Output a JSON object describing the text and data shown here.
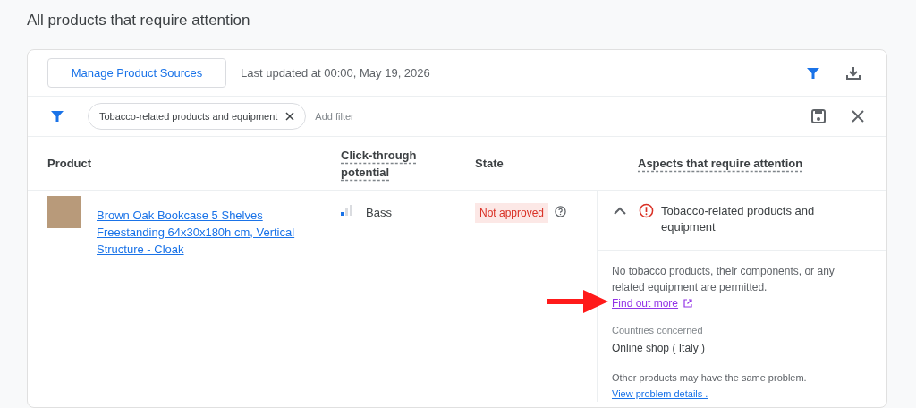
{
  "page_title": "All products that require attention",
  "toolbar": {
    "manage_button": "Manage Product Sources",
    "last_updated": "Last updated at 00:00, May 19, 2026"
  },
  "filter_bar": {
    "chips": [
      {
        "label": "Tobacco-related products and equipment"
      }
    ],
    "add_filter": "Add filter"
  },
  "table": {
    "columns": [
      {
        "label": "Product",
        "has_tooltip": false
      },
      {
        "label": "Click-through potential",
        "has_tooltip": true
      },
      {
        "label": "State",
        "has_tooltip": false
      },
      {
        "label": "Aspects that require attention",
        "has_tooltip": true
      }
    ],
    "rows": [
      {
        "product": "Brown Oak Bookcase 5 Shelves Freestanding 64x30x180h cm, Vertical Structure - Cloak",
        "potential": "Bass",
        "state": "Not approved",
        "aspect": {
          "title": "Tobacco-related products and equipment",
          "expanded": true,
          "description": "No tobacco products, their components, or any related equipment are permitted.",
          "link": "Find out more",
          "countries_label": "Countries concerned",
          "countries": "Online shop ( Italy )",
          "note": "Other products may have the same problem.",
          "details_link": "View problem details ."
        }
      }
    ]
  }
}
